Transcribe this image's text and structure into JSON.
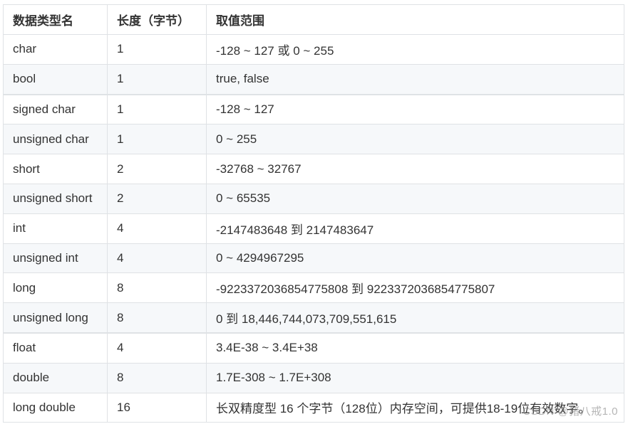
{
  "table": {
    "headers": [
      "数据类型名",
      "长度（字节）",
      "取值范围"
    ],
    "rows": [
      {
        "type": "char",
        "size": "1",
        "range": "-128 ~ 127 或 0 ~ 255"
      },
      {
        "type": "bool",
        "size": "1",
        "range": "true, false"
      },
      {
        "type": "signed char",
        "size": "1",
        "range": "-128 ~ 127"
      },
      {
        "type": "unsigned char",
        "size": "1",
        "range": "0 ~ 255"
      },
      {
        "type": "short",
        "size": "2",
        "range": "-32768 ~ 32767"
      },
      {
        "type": "unsigned short",
        "size": "2",
        "range": "0 ~ 65535"
      },
      {
        "type": "int",
        "size": "4",
        "range": "-2147483648 到 2147483647"
      },
      {
        "type": "unsigned int",
        "size": "4",
        "range": "0 ~ 4294967295"
      },
      {
        "type": "long",
        "size": "8",
        "range": "-9223372036854775808 到 9223372036854775807"
      },
      {
        "type": "unsigned long",
        "size": "8",
        "range": "0 到 18,446,744,073,709,551,615"
      },
      {
        "type": "float",
        "size": "4",
        "range": "3.4E-38 ~ 3.4E+38"
      },
      {
        "type": "double",
        "size": "8",
        "range": "1.7E-308 ~ 1.7E+308"
      },
      {
        "type": "long double",
        "size": "16",
        "range": "长双精度型 16 个字节（128位）内存空间，可提供18-19位有效数字。"
      }
    ]
  },
  "watermark": "CSDN @猪八戒1.0"
}
